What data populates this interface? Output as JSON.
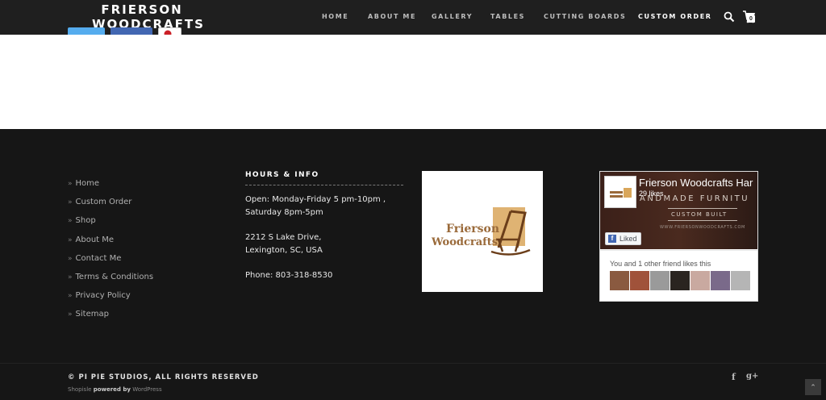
{
  "header": {
    "logo_line1": "FRIERSON",
    "logo_line2": "WOODCRAFTS",
    "nav": [
      "HOME",
      "ABOUT ME",
      "GALLERY",
      "TABLES",
      "CUTTING BOARDS",
      "CUSTOM ORDER"
    ],
    "active_nav": "CUSTOM ORDER",
    "cart_count": "0",
    "icons": [
      "search-icon",
      "cart-icon"
    ]
  },
  "colors": {
    "header_bg": "#1f1f1f",
    "footer_bg": "#161616",
    "facebook_blue": "#4267b2",
    "twitter_blue": "#55acee"
  },
  "footer": {
    "links": [
      "Home",
      "Custom Order",
      "Shop",
      "About Me",
      "Contact Me",
      "Terms & Conditions",
      "Privacy Policy",
      "Sitemap"
    ],
    "hours_title": "HOURS & INFO",
    "hours_line1": "Open: Monday-Friday 5 pm-10pm ,",
    "hours_line2": "Saturday 8pm-5pm",
    "address_line1": "2212 S Lake Drive,",
    "address_line2": "Lexington, SC, USA",
    "phone": "Phone: 803-318-8530",
    "logo_text1": "Frierson",
    "logo_text2": "Woodcrafts"
  },
  "facebook": {
    "page_name": "Frierson Woodcrafts Har",
    "likes": "29 likes",
    "cover_text1": "ANDMADE FURNITU",
    "cover_text2": "CUSTOM BUILT",
    "cover_text3": "WWW.FRIERSONWOODCRAFTS.COM",
    "liked_label": "Liked",
    "friends_text": "You and 1 other friend likes this"
  },
  "bottom": {
    "copyright": "© PI PIE STUDIOS, ALL RIGHTS RESERVED",
    "theme": "Shopisle",
    "powered_by": "powered by",
    "wordpress": "WordPress",
    "social_f": "f",
    "social_g": "g+",
    "to_top": "⌃"
  }
}
